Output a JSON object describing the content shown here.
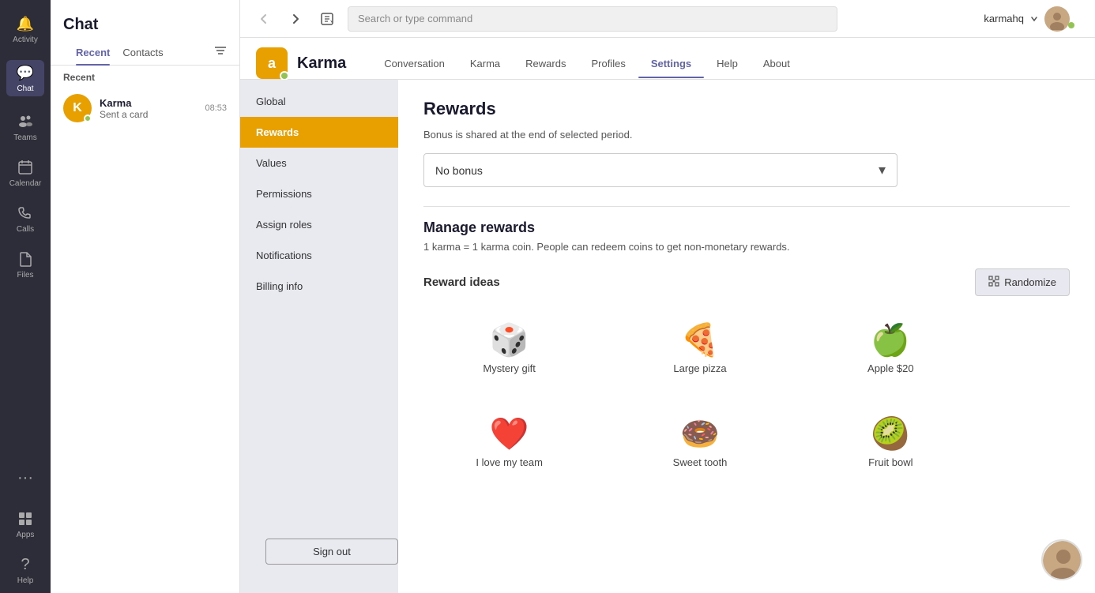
{
  "sidebar": {
    "items": [
      {
        "id": "activity",
        "label": "Activity",
        "icon": "🔔",
        "active": false
      },
      {
        "id": "chat",
        "label": "Chat",
        "icon": "💬",
        "active": true
      },
      {
        "id": "teams",
        "label": "Teams",
        "icon": "👥",
        "active": false
      },
      {
        "id": "calendar",
        "label": "Calendar",
        "icon": "📅",
        "active": false
      },
      {
        "id": "calls",
        "label": "Calls",
        "icon": "📞",
        "active": false
      },
      {
        "id": "files",
        "label": "Files",
        "icon": "📄",
        "active": false
      }
    ],
    "more_icon": "···",
    "apps_label": "Apps",
    "help_label": "Help"
  },
  "chat_panel": {
    "title": "Chat",
    "tabs": [
      {
        "id": "recent",
        "label": "Recent",
        "active": true
      },
      {
        "id": "contacts",
        "label": "Contacts",
        "active": false
      }
    ],
    "section_label": "Recent",
    "items": [
      {
        "name": "Karma",
        "preview": "Sent a card",
        "time": "08:53",
        "avatar_emoji": "K",
        "avatar_bg": "#e8a000"
      }
    ]
  },
  "topbar": {
    "back_disabled": true,
    "forward_disabled": false,
    "search_placeholder": "Search or type command",
    "user_name": "karmahq",
    "user_avatar": "👤"
  },
  "app": {
    "logo_emoji": "🅰",
    "title": "Karma",
    "nav_items": [
      {
        "id": "conversation",
        "label": "Conversation",
        "active": false
      },
      {
        "id": "karma",
        "label": "Karma",
        "active": false
      },
      {
        "id": "rewards",
        "label": "Rewards",
        "active": false
      },
      {
        "id": "profiles",
        "label": "Profiles",
        "active": false
      },
      {
        "id": "settings",
        "label": "Settings",
        "active": true
      },
      {
        "id": "help",
        "label": "Help",
        "active": false
      },
      {
        "id": "about",
        "label": "About",
        "active": false
      }
    ]
  },
  "settings_sidebar": {
    "items": [
      {
        "id": "global",
        "label": "Global",
        "active": false
      },
      {
        "id": "rewards",
        "label": "Rewards",
        "active": true
      },
      {
        "id": "values",
        "label": "Values",
        "active": false
      },
      {
        "id": "permissions",
        "label": "Permissions",
        "active": false
      },
      {
        "id": "assign-roles",
        "label": "Assign roles",
        "active": false
      },
      {
        "id": "notifications",
        "label": "Notifications",
        "active": false
      },
      {
        "id": "billing-info",
        "label": "Billing info",
        "active": false
      }
    ],
    "sign_out_label": "Sign out"
  },
  "rewards_page": {
    "title": "Rewards",
    "bonus_label": "Bonus is shared at the end of selected period.",
    "bonus_dropdown": {
      "value": "No bonus",
      "chevron": "▾"
    },
    "manage_title": "Manage rewards",
    "manage_desc": "1 karma = 1 karma coin. People can redeem coins to get non-monetary rewards.",
    "reward_ideas_label": "Reward ideas",
    "randomize_label": "Randomize",
    "rewards": [
      {
        "emoji": "🎲",
        "label": "Mystery gift"
      },
      {
        "emoji": "🍕",
        "label": "Large pizza"
      },
      {
        "emoji": "🍏",
        "label": "Apple $20"
      },
      {
        "emoji": "❤️",
        "label": "I love my team"
      },
      {
        "emoji": "🍩",
        "label": "Sweet tooth"
      },
      {
        "emoji": "🥝",
        "label": "Fruit bowl"
      }
    ]
  }
}
